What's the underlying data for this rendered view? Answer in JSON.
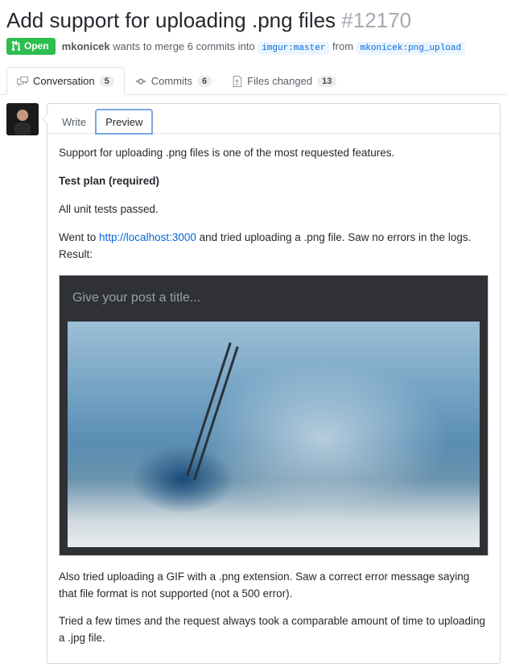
{
  "pr": {
    "title": "Add support for uploading .png files",
    "number": "#12170",
    "state": "Open",
    "author": "mkonicek",
    "merge_text_1": "wants to merge 6 commits into",
    "base_branch": "imgur:master",
    "merge_text_2": "from",
    "head_branch": "mkonicek:png_upload"
  },
  "tabs": {
    "conversation": {
      "label": "Conversation",
      "count": "5"
    },
    "commits": {
      "label": "Commits",
      "count": "6"
    },
    "files": {
      "label": "Files changed",
      "count": "13"
    }
  },
  "editor_tabs": {
    "write": "Write",
    "preview": "Preview"
  },
  "comment": {
    "p1": "Support for uploading .png files is one of the most requested features.",
    "heading": "Test plan (required)",
    "p2": "All unit tests passed.",
    "p3a": "Went to ",
    "link": "http://localhost:3000",
    "p3b": " and tried uploading a .png file. Saw no errors in the logs. Result:",
    "embed_placeholder": "Give your post a title...",
    "p4": "Also tried uploading a GIF with a .png extension. Saw a correct error message saying that file format is not supported (not a 500 error).",
    "p5": "Tried a few times and the request always took a comparable amount of time to uploading a .jpg file."
  }
}
